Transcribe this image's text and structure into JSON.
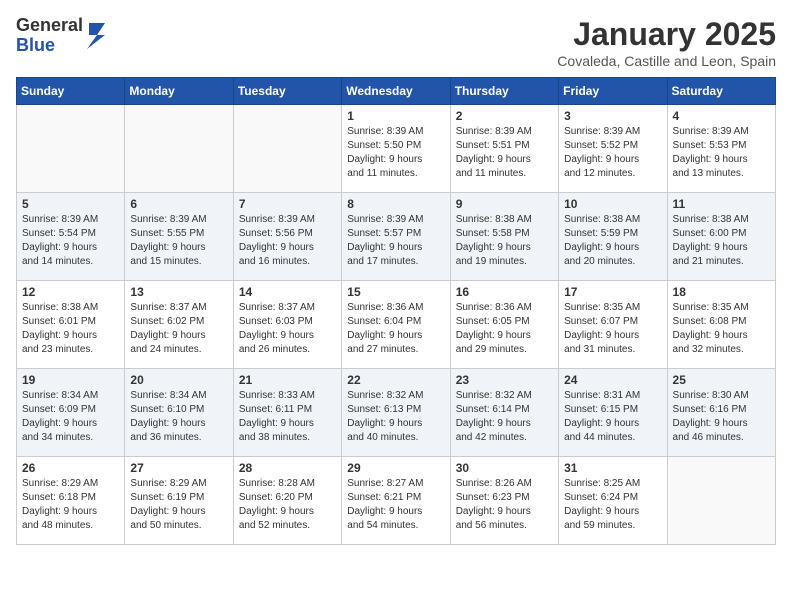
{
  "header": {
    "logo_general": "General",
    "logo_blue": "Blue",
    "month_title": "January 2025",
    "location": "Covaleda, Castille and Leon, Spain"
  },
  "weekdays": [
    "Sunday",
    "Monday",
    "Tuesday",
    "Wednesday",
    "Thursday",
    "Friday",
    "Saturday"
  ],
  "weeks": [
    [
      {
        "day": "",
        "detail": ""
      },
      {
        "day": "",
        "detail": ""
      },
      {
        "day": "",
        "detail": ""
      },
      {
        "day": "1",
        "detail": "Sunrise: 8:39 AM\nSunset: 5:50 PM\nDaylight: 9 hours\nand 11 minutes."
      },
      {
        "day": "2",
        "detail": "Sunrise: 8:39 AM\nSunset: 5:51 PM\nDaylight: 9 hours\nand 11 minutes."
      },
      {
        "day": "3",
        "detail": "Sunrise: 8:39 AM\nSunset: 5:52 PM\nDaylight: 9 hours\nand 12 minutes."
      },
      {
        "day": "4",
        "detail": "Sunrise: 8:39 AM\nSunset: 5:53 PM\nDaylight: 9 hours\nand 13 minutes."
      }
    ],
    [
      {
        "day": "5",
        "detail": "Sunrise: 8:39 AM\nSunset: 5:54 PM\nDaylight: 9 hours\nand 14 minutes."
      },
      {
        "day": "6",
        "detail": "Sunrise: 8:39 AM\nSunset: 5:55 PM\nDaylight: 9 hours\nand 15 minutes."
      },
      {
        "day": "7",
        "detail": "Sunrise: 8:39 AM\nSunset: 5:56 PM\nDaylight: 9 hours\nand 16 minutes."
      },
      {
        "day": "8",
        "detail": "Sunrise: 8:39 AM\nSunset: 5:57 PM\nDaylight: 9 hours\nand 17 minutes."
      },
      {
        "day": "9",
        "detail": "Sunrise: 8:38 AM\nSunset: 5:58 PM\nDaylight: 9 hours\nand 19 minutes."
      },
      {
        "day": "10",
        "detail": "Sunrise: 8:38 AM\nSunset: 5:59 PM\nDaylight: 9 hours\nand 20 minutes."
      },
      {
        "day": "11",
        "detail": "Sunrise: 8:38 AM\nSunset: 6:00 PM\nDaylight: 9 hours\nand 21 minutes."
      }
    ],
    [
      {
        "day": "12",
        "detail": "Sunrise: 8:38 AM\nSunset: 6:01 PM\nDaylight: 9 hours\nand 23 minutes."
      },
      {
        "day": "13",
        "detail": "Sunrise: 8:37 AM\nSunset: 6:02 PM\nDaylight: 9 hours\nand 24 minutes."
      },
      {
        "day": "14",
        "detail": "Sunrise: 8:37 AM\nSunset: 6:03 PM\nDaylight: 9 hours\nand 26 minutes."
      },
      {
        "day": "15",
        "detail": "Sunrise: 8:36 AM\nSunset: 6:04 PM\nDaylight: 9 hours\nand 27 minutes."
      },
      {
        "day": "16",
        "detail": "Sunrise: 8:36 AM\nSunset: 6:05 PM\nDaylight: 9 hours\nand 29 minutes."
      },
      {
        "day": "17",
        "detail": "Sunrise: 8:35 AM\nSunset: 6:07 PM\nDaylight: 9 hours\nand 31 minutes."
      },
      {
        "day": "18",
        "detail": "Sunrise: 8:35 AM\nSunset: 6:08 PM\nDaylight: 9 hours\nand 32 minutes."
      }
    ],
    [
      {
        "day": "19",
        "detail": "Sunrise: 8:34 AM\nSunset: 6:09 PM\nDaylight: 9 hours\nand 34 minutes."
      },
      {
        "day": "20",
        "detail": "Sunrise: 8:34 AM\nSunset: 6:10 PM\nDaylight: 9 hours\nand 36 minutes."
      },
      {
        "day": "21",
        "detail": "Sunrise: 8:33 AM\nSunset: 6:11 PM\nDaylight: 9 hours\nand 38 minutes."
      },
      {
        "day": "22",
        "detail": "Sunrise: 8:32 AM\nSunset: 6:13 PM\nDaylight: 9 hours\nand 40 minutes."
      },
      {
        "day": "23",
        "detail": "Sunrise: 8:32 AM\nSunset: 6:14 PM\nDaylight: 9 hours\nand 42 minutes."
      },
      {
        "day": "24",
        "detail": "Sunrise: 8:31 AM\nSunset: 6:15 PM\nDaylight: 9 hours\nand 44 minutes."
      },
      {
        "day": "25",
        "detail": "Sunrise: 8:30 AM\nSunset: 6:16 PM\nDaylight: 9 hours\nand 46 minutes."
      }
    ],
    [
      {
        "day": "26",
        "detail": "Sunrise: 8:29 AM\nSunset: 6:18 PM\nDaylight: 9 hours\nand 48 minutes."
      },
      {
        "day": "27",
        "detail": "Sunrise: 8:29 AM\nSunset: 6:19 PM\nDaylight: 9 hours\nand 50 minutes."
      },
      {
        "day": "28",
        "detail": "Sunrise: 8:28 AM\nSunset: 6:20 PM\nDaylight: 9 hours\nand 52 minutes."
      },
      {
        "day": "29",
        "detail": "Sunrise: 8:27 AM\nSunset: 6:21 PM\nDaylight: 9 hours\nand 54 minutes."
      },
      {
        "day": "30",
        "detail": "Sunrise: 8:26 AM\nSunset: 6:23 PM\nDaylight: 9 hours\nand 56 minutes."
      },
      {
        "day": "31",
        "detail": "Sunrise: 8:25 AM\nSunset: 6:24 PM\nDaylight: 9 hours\nand 59 minutes."
      },
      {
        "day": "",
        "detail": ""
      }
    ]
  ]
}
